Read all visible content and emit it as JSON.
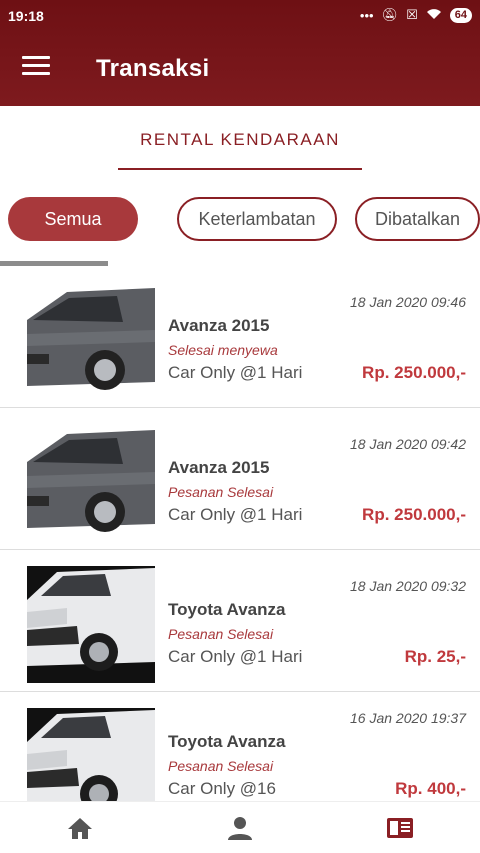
{
  "status_bar": {
    "time": "19:18",
    "battery": "64"
  },
  "header": {
    "title": "Transaksi"
  },
  "tab": {
    "label": "RENTAL KENDARAAN"
  },
  "filters": [
    "Semua",
    "Keterlambatan",
    "Dibatalkan"
  ],
  "transactions": [
    {
      "name": "Avanza 2015",
      "date": "18 Jan 2020 09:46",
      "status": "Selesai menyewa",
      "package": "Car Only @1 Hari",
      "price": "Rp. 250.000,-",
      "car_color": "grey"
    },
    {
      "name": "Avanza 2015",
      "date": "18 Jan 2020 09:42",
      "status": "Pesanan Selesai",
      "package": "Car Only @1 Hari",
      "price": "Rp. 250.000,-",
      "car_color": "grey"
    },
    {
      "name": "Toyota Avanza",
      "date": "18 Jan 2020 09:32",
      "status": "Pesanan Selesai",
      "package": "Car Only @1 Hari",
      "price": "Rp. 25,-",
      "car_color": "white"
    },
    {
      "name": "Toyota Avanza",
      "date": "16 Jan 2020 19:37",
      "status": "Pesanan Selesai",
      "package": "Car Only @16",
      "price": "Rp. 400,-",
      "car_color": "white"
    }
  ],
  "colors": {
    "primary": "#7a1518",
    "accent": "#a8393c",
    "price": "#c0393d"
  },
  "bottom_nav": [
    "home-icon",
    "person-icon",
    "receipt-icon"
  ]
}
